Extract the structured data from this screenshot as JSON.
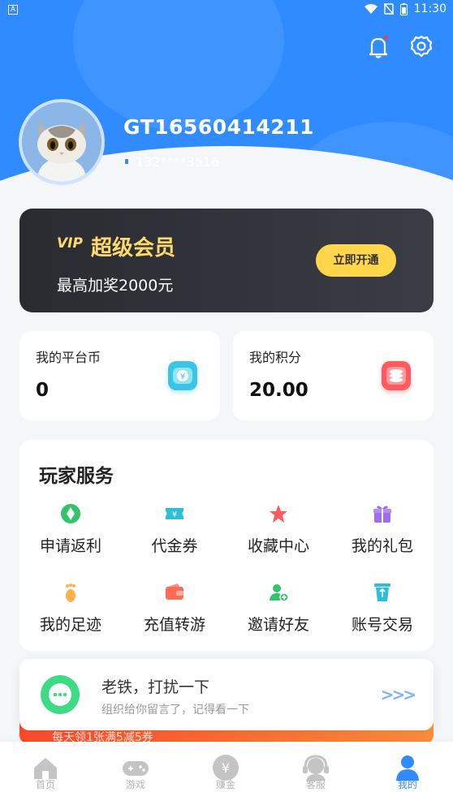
{
  "status_bar": {
    "time": "11:30",
    "left_indicator": "A"
  },
  "profile": {
    "username": "GT16560414211",
    "phone": "132****3516"
  },
  "vip": {
    "badge": "VIP",
    "title": "超级会员",
    "subtitle": "最高加奖2000元",
    "button": "立即开通"
  },
  "stats": [
    {
      "label": "我的平台币",
      "value": "0",
      "icon": "coin-icon",
      "color": "#39c6e6"
    },
    {
      "label": "我的积分",
      "value": "20.00",
      "icon": "database-icon",
      "color": "#ff5a5f"
    }
  ],
  "services": {
    "title": "玩家服务",
    "items": [
      {
        "label": "申请返利",
        "icon": "diamond-icon",
        "color": "#31c46b"
      },
      {
        "label": "代金券",
        "icon": "ticket-icon",
        "color": "#2dbfd5"
      },
      {
        "label": "收藏中心",
        "icon": "star-icon",
        "color": "#ff5a5f"
      },
      {
        "label": "我的礼包",
        "icon": "gift-icon",
        "color": "#a06cf0"
      },
      {
        "label": "我的足迹",
        "icon": "footprint-icon",
        "color": "#ffb24a"
      },
      {
        "label": "充值转游",
        "icon": "wallet-icon",
        "color": "#ff6b57"
      },
      {
        "label": "邀请好友",
        "icon": "add-user-icon",
        "color": "#31c46b"
      },
      {
        "label": "账号交易",
        "icon": "recycle-icon",
        "color": "#2dbfd5"
      }
    ]
  },
  "notification": {
    "title": "老铁，打扰一下",
    "subtitle": "组织给你留言了，记得看一下",
    "icon": "chat-icon"
  },
  "promo": {
    "text": "每天领1张满5减5券"
  },
  "tabs": [
    {
      "label": "首页",
      "icon": "home-icon",
      "active": false
    },
    {
      "label": "游戏",
      "icon": "gamepad-icon",
      "active": false
    },
    {
      "label": "赚金",
      "icon": "yen-coin-icon",
      "active": false
    },
    {
      "label": "客服",
      "icon": "headset-icon",
      "active": false
    },
    {
      "label": "我的",
      "icon": "user-icon",
      "active": true
    }
  ],
  "colors": {
    "accent": "#2f8bff",
    "vip_gold": "#ffd96a",
    "background": "#f5f6f8"
  }
}
